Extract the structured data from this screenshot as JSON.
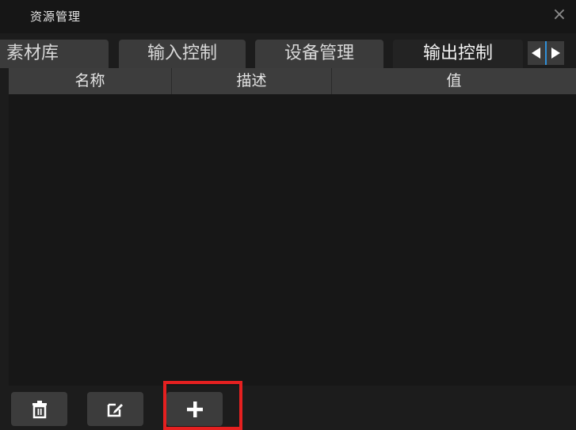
{
  "window": {
    "title": "资源管理"
  },
  "tabs": [
    {
      "label": "素材库"
    },
    {
      "label": "输入控制"
    },
    {
      "label": "设备管理"
    },
    {
      "label": "输出控制"
    }
  ],
  "table": {
    "columns": [
      "名称",
      "描述",
      "值"
    ],
    "rows": []
  },
  "toolbar": {
    "delete_icon": "trash-icon",
    "edit_icon": "edit-icon",
    "add_icon": "plus-icon"
  },
  "colors": {
    "highlight": "#e52020",
    "active_indicator": "#2f8fd8"
  }
}
